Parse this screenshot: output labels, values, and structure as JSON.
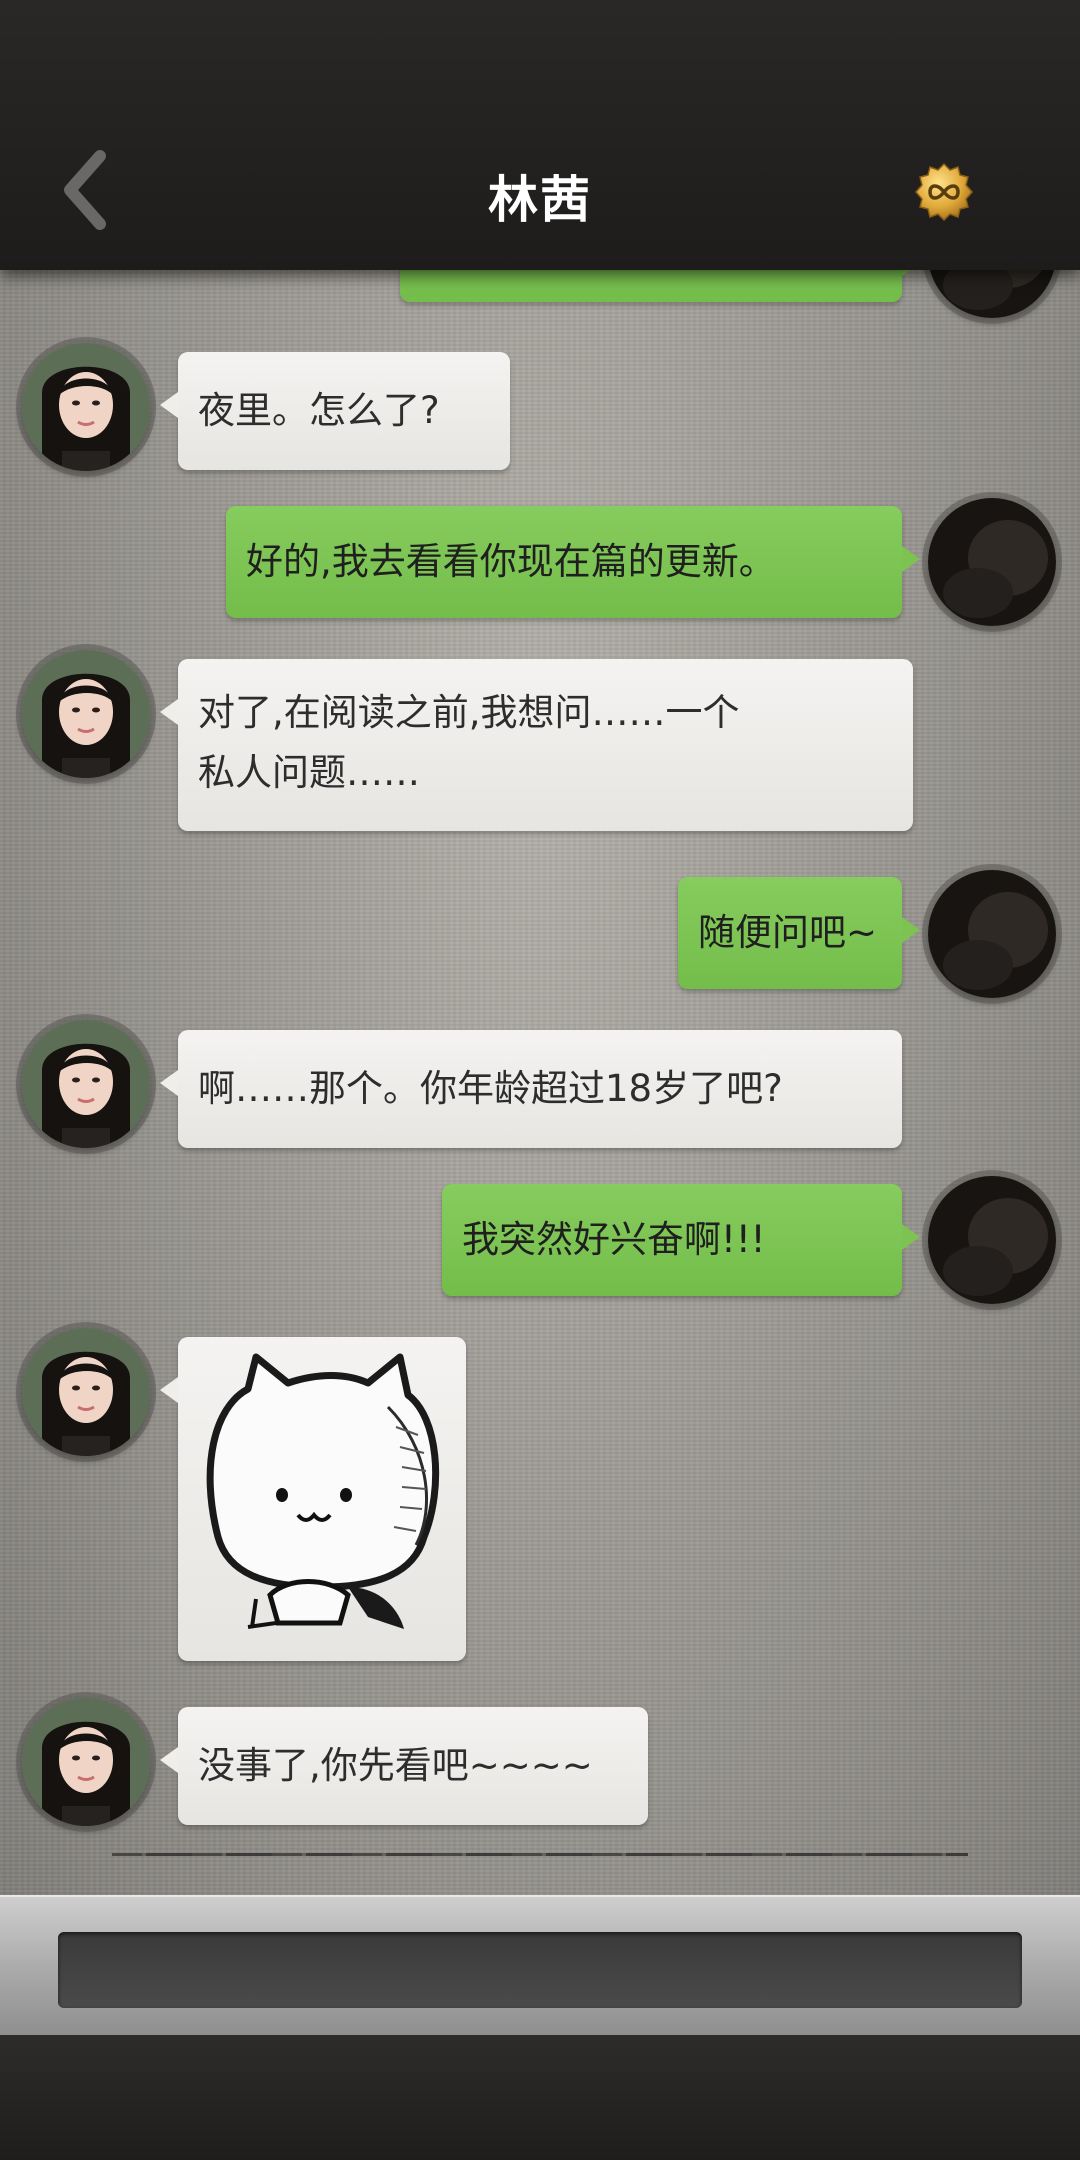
{
  "header": {
    "title": "林茜"
  },
  "messages": [
    {
      "from": "me",
      "text": ""
    },
    {
      "from": "contact",
      "text": "夜里。怎么了?"
    },
    {
      "from": "me",
      "text": "好的,我去看看你现在篇的更新。"
    },
    {
      "from": "contact",
      "line1": "对了,在阅读之前,我想问……一个",
      "line2": "私人问题……"
    },
    {
      "from": "me",
      "text": "随便问吧~"
    },
    {
      "from": "contact",
      "text": "啊……那个。你年龄超过18岁了吧?"
    },
    {
      "from": "me",
      "text": "我突然好兴奋啊!!!"
    },
    {
      "from": "contact",
      "type": "sticker",
      "sticker": "cat-sticker"
    },
    {
      "from": "contact",
      "text": "没事了,你先看吧~~~~"
    }
  ],
  "input": {
    "placeholder": ""
  },
  "icons": {
    "back": "chevron-left-icon",
    "coin": "infinity-coin-icon",
    "contact_avatar": "girl-portrait-avatar",
    "me_avatar": "dark-avatar"
  },
  "colors": {
    "header_bg": "#232120",
    "incoming_bubble": "#eeedea",
    "outgoing_bubble": "#7cc352",
    "coin": "#e0a93a",
    "title_text": "#ffffff"
  }
}
